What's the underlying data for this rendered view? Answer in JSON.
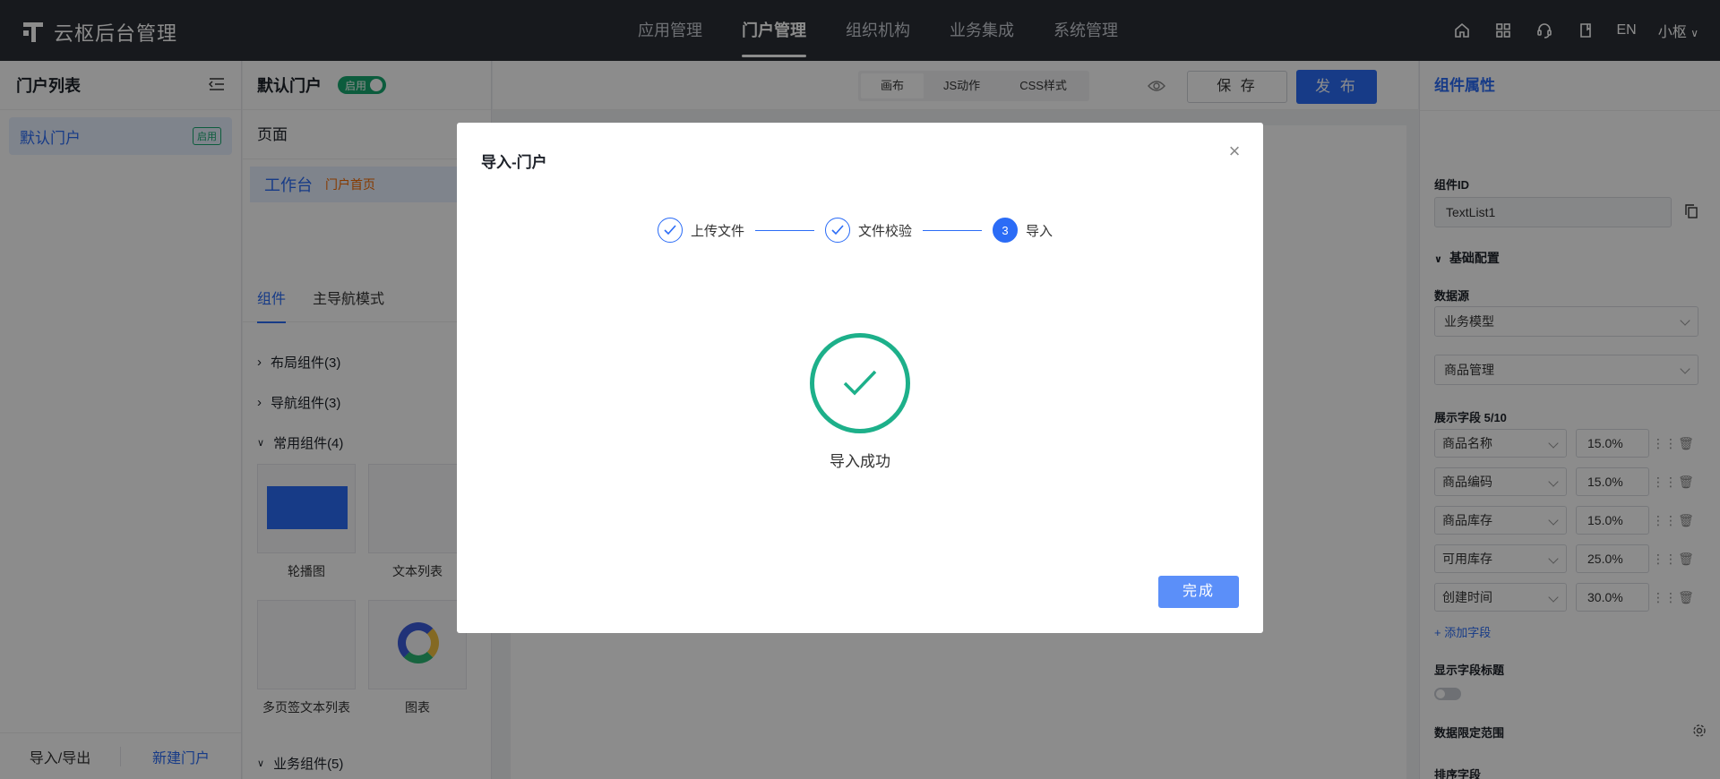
{
  "app": {
    "title": "云枢后台管理"
  },
  "nav": {
    "items": [
      "应用管理",
      "门户管理",
      "组织机构",
      "业务集成",
      "系统管理"
    ],
    "active_index": 1
  },
  "topbar": {
    "lang": "EN",
    "user": "小枢",
    "icons": [
      "home-icon",
      "apps-grid-icon",
      "support-icon",
      "book-icon"
    ]
  },
  "portal_list": {
    "title": "门户列表",
    "items": [
      {
        "label": "默认门户",
        "badge": "启用"
      }
    ],
    "footer": {
      "import_export": "导入/导出",
      "new_portal": "新建门户"
    }
  },
  "page_panel": {
    "portal_name": "默认门户",
    "toggle_label": "启用",
    "pages_title": "页面",
    "pages": [
      {
        "name": "工作台",
        "tag": "门户首页"
      }
    ],
    "tabs": [
      "组件",
      "主导航模式"
    ],
    "categories": [
      "布局组件(3)",
      "导航组件(3)",
      "常用组件(4)",
      "业务组件(5)"
    ],
    "widgets": [
      "轮播图",
      "文本列表",
      "多页签文本列表",
      "图表"
    ]
  },
  "canvas": {
    "mode_tabs": [
      "画布",
      "JS动作",
      "CSS样式"
    ],
    "active_mode": 0,
    "save_label": "保 存",
    "publish_label": "发 布"
  },
  "properties": {
    "title": "组件属性",
    "component_id_label": "组件ID",
    "component_id": "TextList1",
    "basic_config": "基础配置",
    "datasource_label": "数据源",
    "datasource": "业务模型",
    "model": "商品管理",
    "fields_label": "展示字段  5/10",
    "fields": [
      {
        "name": "商品名称",
        "width": "15.0%"
      },
      {
        "name": "商品编码",
        "width": "15.0%"
      },
      {
        "name": "商品库存",
        "width": "15.0%"
      },
      {
        "name": "可用库存",
        "width": "25.0%"
      },
      {
        "name": "创建时间",
        "width": "30.0%"
      }
    ],
    "add_field": "+ 添加字段",
    "show_field_title": "显示字段标题",
    "data_scope": "数据限定范围",
    "sort_field": "排序字段"
  },
  "modal": {
    "title": "导入-门户",
    "steps": [
      {
        "label": "上传文件",
        "status": "done"
      },
      {
        "label": "文件校验",
        "status": "done"
      },
      {
        "label": "导入",
        "status": "current",
        "number": "3"
      }
    ],
    "result": "导入成功",
    "done_label": "完成",
    "colors": {
      "success": "#1db08a",
      "primary": "#2b6cf6"
    }
  }
}
